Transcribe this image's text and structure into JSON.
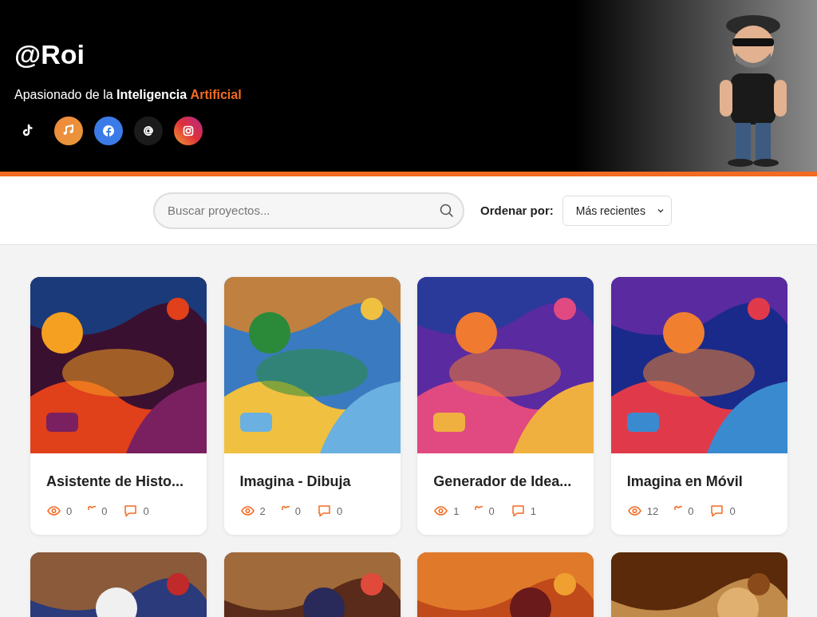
{
  "profile": {
    "handle": "@Roi",
    "bio": "Apasionado de la **Inteligencia**",
    "bio_highlight": "Artificial",
    "socials": [
      {
        "kind": "tiktok"
      },
      {
        "kind": "music"
      },
      {
        "kind": "facebook"
      },
      {
        "kind": "threads"
      },
      {
        "kind": "instagram"
      }
    ]
  },
  "search": {
    "placeholder": "Buscar proyectos..."
  },
  "sort": {
    "label": "Ordenar por:",
    "value": "Más recientes"
  },
  "projects": [
    {
      "kind": "full",
      "title": "Asistente de Histo...",
      "views": "0",
      "likes": "0",
      "comments": "0"
    },
    {
      "kind": "full",
      "title": "Imagina - Dibuja",
      "views": "2",
      "likes": "0",
      "comments": "0"
    },
    {
      "kind": "full",
      "title": "Generador de Idea...",
      "views": "1",
      "likes": "0",
      "comments": "1"
    },
    {
      "kind": "full",
      "title": "Imagina en Móvil",
      "views": "12",
      "likes": "0",
      "comments": "0"
    },
    {
      "kind": "cut"
    },
    {
      "kind": "cut"
    },
    {
      "kind": "cut"
    },
    {
      "kind": "cut"
    }
  ]
}
